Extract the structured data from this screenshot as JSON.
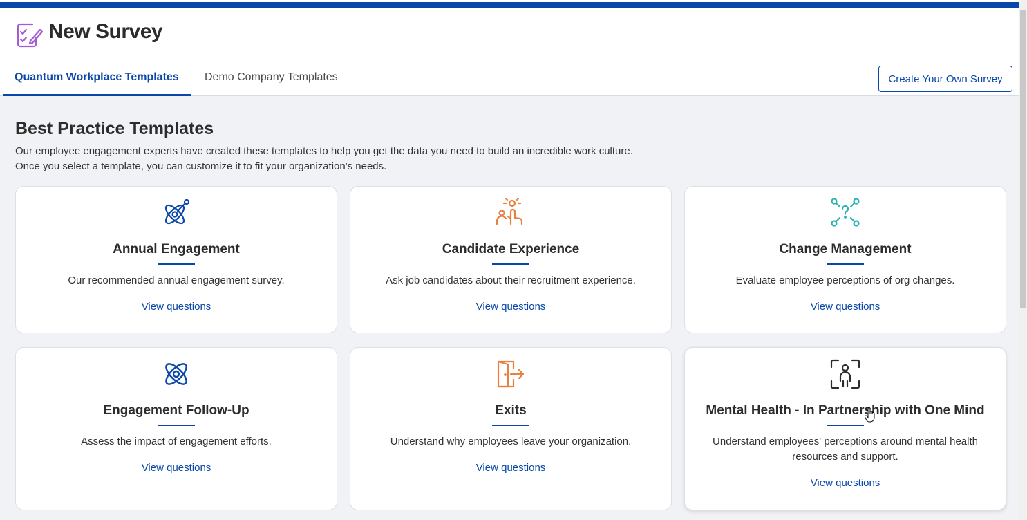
{
  "header": {
    "title": "New Survey",
    "logo_icon": "survey-checklist-pencil-icon"
  },
  "tabs": [
    {
      "label": "Quantum Workplace Templates",
      "active": true
    },
    {
      "label": "Demo Company Templates",
      "active": false
    }
  ],
  "create_button": "Create Your Own Survey",
  "section": {
    "title": "Best Practice Templates",
    "description_line1": "Our employee engagement experts have created these templates to help you get the data you need to build an incredible work culture.",
    "description_line2": "Once you select a template, you can customize it to fit your organization's needs."
  },
  "cards": [
    {
      "title": "Annual Engagement",
      "description": "Our recommended annual engagement survey.",
      "link": "View questions",
      "icon": "orbit-atom-icon",
      "icon_color": "#0a47a8"
    },
    {
      "title": "Candidate Experience",
      "description": "Ask job candidates about their recruitment experience.",
      "link": "View questions",
      "icon": "candidate-hand-raise-icon",
      "icon_color": "#e8803f"
    },
    {
      "title": "Change Management",
      "description": "Evaluate employee perceptions of org changes.",
      "link": "View questions",
      "icon": "branching-question-icon",
      "icon_color": "#2ab3b1"
    },
    {
      "title": "Engagement Follow-Up",
      "description": "Assess the impact of engagement efforts.",
      "link": "View questions",
      "icon": "atom-icon",
      "icon_color": "#0a47a8"
    },
    {
      "title": "Exits",
      "description": "Understand why employees leave your organization.",
      "link": "View questions",
      "icon": "door-exit-icon",
      "icon_color": "#e8803f"
    },
    {
      "title": "Mental Health - In Partnership with One Mind",
      "description": "Understand employees' perceptions around mental health resources and support.",
      "link": "View questions",
      "icon": "person-focus-frame-icon",
      "icon_color": "#2c2c2c"
    }
  ],
  "colors": {
    "brand_blue": "#0a47a8",
    "background": "#f1f2f5"
  }
}
